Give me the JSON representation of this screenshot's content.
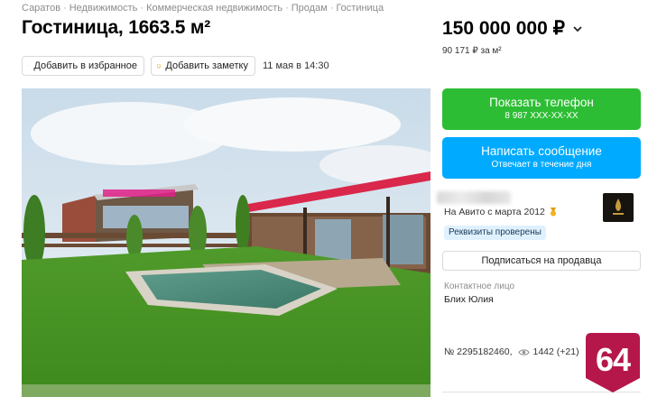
{
  "breadcrumb": [
    "Саратов",
    "Недвижимость",
    "Коммерческая недвижимость",
    "Продам",
    "Гостиница"
  ],
  "breadcrumb_separator": "·",
  "listing": {
    "title": "Гостиница, 1663.5 м²",
    "price": "150 000 000 ₽",
    "price_per_sqm": "90 171 ₽ за м²",
    "published": "11 мая в 14:30"
  },
  "actions": {
    "favorite_label": "Добавить в избранное",
    "note_label": "Добавить заметку"
  },
  "contact": {
    "phone_button_label": "Показать телефон",
    "phone_masked": "8 987 XXX-XX-XX",
    "message_button_label": "Написать сообщение",
    "message_sublabel": "Отвечает в течение дня"
  },
  "seller": {
    "since": "На Авито с марта 2012",
    "verified_badge": "Реквизиты проверены",
    "subscribe_label": "Подписаться на продавца",
    "contact_person_label": "Контактное лицо",
    "contact_person_name": "Блих Юлия"
  },
  "ad": {
    "number": "№ 2295182460,",
    "views": "1442 (+21)"
  },
  "watermark": {
    "text": "64",
    "color": "#b5174a"
  },
  "colors": {
    "phone_button": "#2dbd34",
    "message_button": "#00aaff",
    "verified_bg": "#dff1ff"
  },
  "icons": {
    "favorite": "heart-icon",
    "note": "note-icon",
    "price_toggle": "chevron-down-icon",
    "seller_rating": "medal-icon",
    "views": "eye-icon"
  }
}
